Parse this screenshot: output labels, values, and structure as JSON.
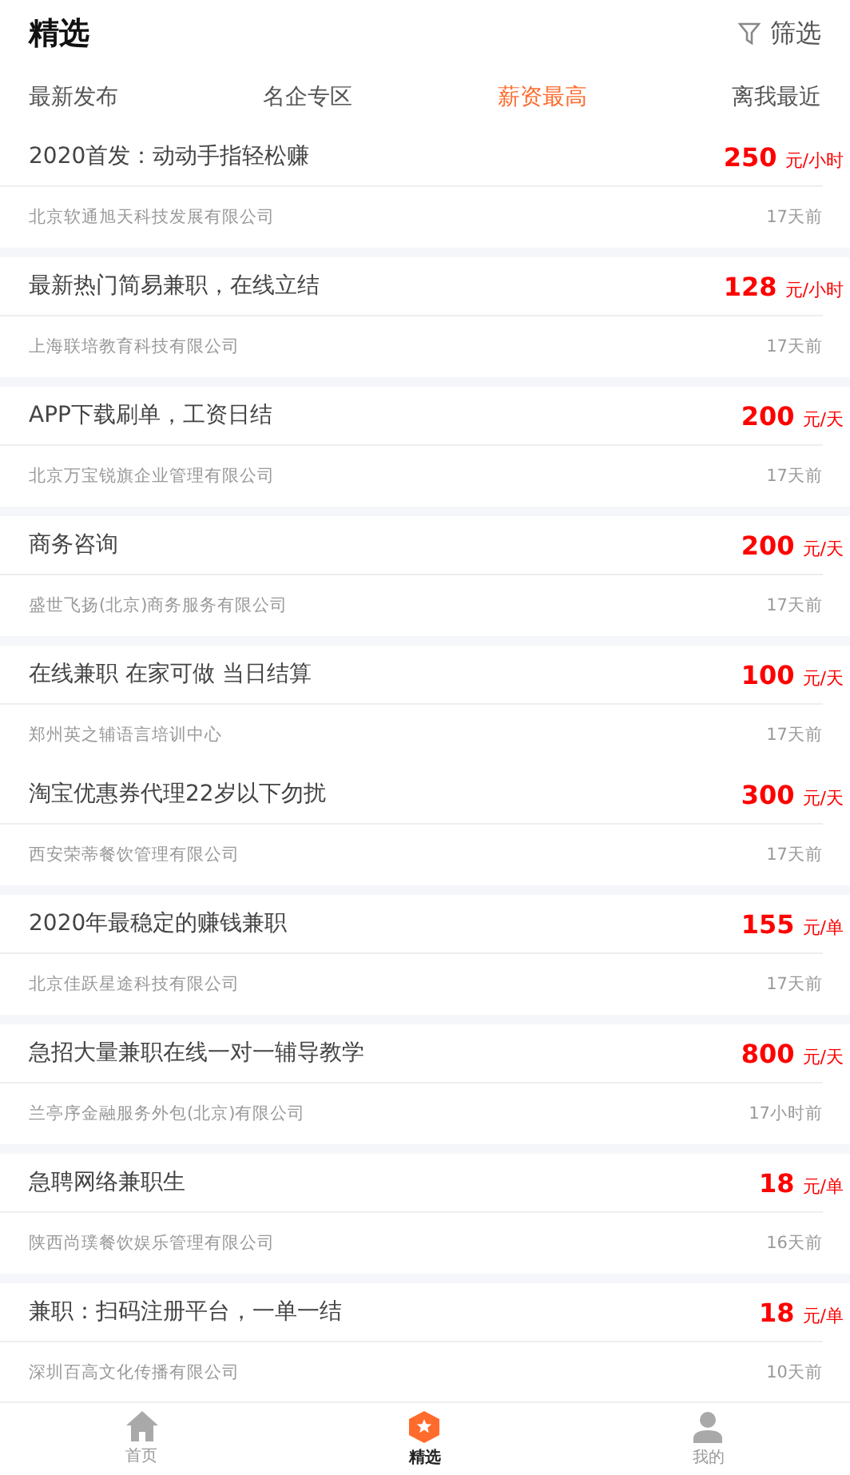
{
  "header": {
    "title": "精选",
    "filter_label": "筛选"
  },
  "tabs": [
    {
      "label": "最新发布",
      "selected": false
    },
    {
      "label": "名企专区",
      "selected": false
    },
    {
      "label": "薪资最高",
      "selected": true
    },
    {
      "label": "离我最近",
      "selected": false
    }
  ],
  "cards": [
    {
      "jobs": [
        {
          "title": "2020首发：动动手指轻松赚",
          "amount": "250",
          "unit": "元/小时",
          "company": "北京软通旭天科技发展有限公司",
          "time": "17天前"
        }
      ]
    },
    {
      "jobs": [
        {
          "title": "最新热门简易兼职，在线立结",
          "amount": "128",
          "unit": "元/小时",
          "company": "上海联培教育科技有限公司",
          "time": "17天前"
        }
      ]
    },
    {
      "jobs": [
        {
          "title": "APP下载刷单，工资日结",
          "amount": "200",
          "unit": "元/天",
          "company": "北京万宝锐旗企业管理有限公司",
          "time": "17天前"
        }
      ]
    },
    {
      "jobs": [
        {
          "title": "商务咨询",
          "amount": "200",
          "unit": "元/天",
          "company": "盛世飞扬(北京)商务服务有限公司",
          "time": "17天前"
        }
      ]
    },
    {
      "jobs": [
        {
          "title": "在线兼职 在家可做 当日结算",
          "amount": "100",
          "unit": "元/天",
          "company": "郑州英之辅语言培训中心",
          "time": "17天前"
        },
        {
          "title": "淘宝优惠券代理22岁以下勿扰",
          "amount": "300",
          "unit": "元/天",
          "company": "西安荣蒂餐饮管理有限公司",
          "time": "17天前"
        }
      ]
    },
    {
      "jobs": [
        {
          "title": "2020年最稳定的赚钱兼职",
          "amount": "155",
          "unit": "元/单",
          "company": "北京佳跃星途科技有限公司",
          "time": "17天前"
        }
      ]
    },
    {
      "jobs": [
        {
          "title": "急招大量兼职在线一对一辅导教学",
          "amount": "800",
          "unit": "元/天",
          "company": "兰亭序金融服务外包(北京)有限公司",
          "time": "17小时前"
        }
      ]
    },
    {
      "jobs": [
        {
          "title": "急聘网络兼职生",
          "amount": "18",
          "unit": "元/单",
          "company": "陕西尚璞餐饮娱乐管理有限公司",
          "time": "16天前"
        }
      ]
    },
    {
      "jobs": [
        {
          "title": "兼职：扫码注册平台，一单一结",
          "amount": "18",
          "unit": "元/单",
          "company": "深圳百高文化传播有限公司",
          "time": "10天前"
        }
      ]
    }
  ],
  "bottom_nav": [
    {
      "kind": "home",
      "label": "首页",
      "selected": false
    },
    {
      "kind": "featured",
      "label": "精选",
      "selected": true
    },
    {
      "kind": "profile",
      "label": "我的",
      "selected": false
    }
  ]
}
